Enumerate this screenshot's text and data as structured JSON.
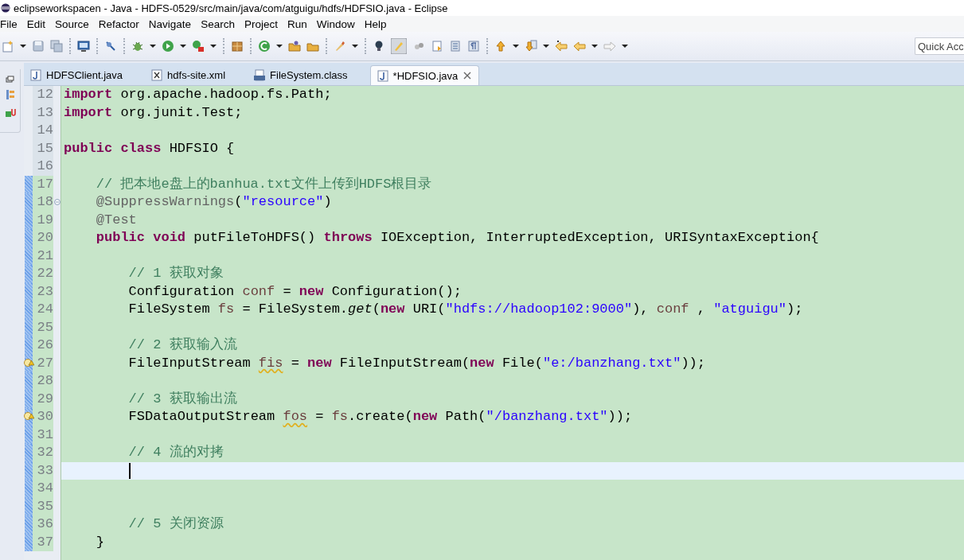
{
  "window": {
    "title": "eclipseworkspacen - Java - HDFS-0529/src/main/java/com/atguigu/hdfs/HDFSIO.java - Eclipse"
  },
  "menu": [
    "File",
    "Edit",
    "Source",
    "Refactor",
    "Navigate",
    "Search",
    "Project",
    "Run",
    "Window",
    "Help"
  ],
  "quick_access": {
    "placeholder": "Quick Acc"
  },
  "tabs": [
    {
      "label": "HDFSClient.java",
      "kind": "java",
      "selected": false
    },
    {
      "label": "hdfs-site.xml",
      "kind": "xml",
      "selected": false
    },
    {
      "label": "FileSystem.class",
      "kind": "class",
      "selected": false
    },
    {
      "label": "*HDFSIO.java",
      "kind": "java",
      "selected": true
    }
  ],
  "editor": {
    "lines": [
      {
        "number": "12",
        "changed": false,
        "warning": false,
        "foldable": false,
        "current": false,
        "tokens": [
          {
            "kind": "keyword",
            "text": "import"
          },
          {
            "kind": "plain",
            "text": " org.apache.hadoop.fs.Path;"
          }
        ]
      },
      {
        "number": "13",
        "changed": false,
        "warning": false,
        "foldable": false,
        "current": false,
        "tokens": [
          {
            "kind": "keyword",
            "text": "import"
          },
          {
            "kind": "plain",
            "text": " org.junit.Test;"
          }
        ]
      },
      {
        "number": "14",
        "changed": false,
        "warning": false,
        "foldable": false,
        "current": false
      },
      {
        "number": "15",
        "changed": false,
        "warning": false,
        "foldable": false,
        "current": false,
        "tokens": [
          {
            "kind": "keyword",
            "text": "public"
          },
          {
            "kind": "keyword",
            "text": " class"
          },
          {
            "kind": "plain",
            "text": " HDFSIO {"
          }
        ]
      },
      {
        "number": "16",
        "changed": false,
        "warning": false,
        "foldable": false,
        "current": false
      },
      {
        "number": "17",
        "changed": true,
        "warning": false,
        "foldable": false,
        "current": false,
        "tokens": [
          {
            "kind": "comment",
            "text": "    // 把本地e盘上的banhua.txt文件上传到HDFS根目录"
          }
        ]
      },
      {
        "number": "18",
        "changed": true,
        "warning": false,
        "foldable": true,
        "current": false,
        "tokens": [
          {
            "kind": "annotation",
            "text": "    @SuppressWarnings"
          },
          {
            "kind": "plain",
            "text": "("
          },
          {
            "kind": "string",
            "text": "\"resource\""
          },
          {
            "kind": "plain",
            "text": ")"
          }
        ]
      },
      {
        "number": "19",
        "changed": true,
        "warning": false,
        "foldable": false,
        "current": false,
        "tokens": [
          {
            "kind": "annotation",
            "text": "    @Test"
          }
        ]
      },
      {
        "number": "20",
        "changed": true,
        "warning": false,
        "foldable": false,
        "current": false,
        "tokens": [
          {
            "kind": "keyword",
            "text": "    public"
          },
          {
            "kind": "keyword",
            "text": " void"
          },
          {
            "kind": "plain",
            "text": " putFileToHDFS() "
          },
          {
            "kind": "keyword",
            "text": "throws"
          },
          {
            "kind": "plain",
            "text": " IOException, InterruptedException, URISyntaxException{"
          }
        ]
      },
      {
        "number": "21",
        "changed": true,
        "warning": false,
        "foldable": false,
        "current": false
      },
      {
        "number": "22",
        "changed": true,
        "warning": false,
        "foldable": false,
        "current": false,
        "tokens": [
          {
            "kind": "comment",
            "text": "        // 1 获取对象"
          }
        ]
      },
      {
        "number": "23",
        "changed": true,
        "warning": false,
        "foldable": false,
        "current": false,
        "tokens": [
          {
            "kind": "plain",
            "text": "        Configuration "
          },
          {
            "kind": "local",
            "text": "conf"
          },
          {
            "kind": "plain",
            "text": " = "
          },
          {
            "kind": "keyword",
            "text": "new"
          },
          {
            "kind": "plain",
            "text": " Configuration();"
          }
        ]
      },
      {
        "number": "24",
        "changed": true,
        "warning": false,
        "foldable": false,
        "current": false,
        "tokens": [
          {
            "kind": "plain",
            "text": "        FileSystem "
          },
          {
            "kind": "local",
            "text": "fs"
          },
          {
            "kind": "plain",
            "text": " = FileSystem."
          },
          {
            "kind": "static_method",
            "text": "get"
          },
          {
            "kind": "plain",
            "text": "("
          },
          {
            "kind": "keyword",
            "text": "new"
          },
          {
            "kind": "plain",
            "text": " URI("
          },
          {
            "kind": "string",
            "text": "\"hdfs://hadoop102:9000\""
          },
          {
            "kind": "plain",
            "text": "), "
          },
          {
            "kind": "local",
            "text": "conf"
          },
          {
            "kind": "plain",
            "text": " , "
          },
          {
            "kind": "string",
            "text": "\"atguigu\""
          },
          {
            "kind": "plain",
            "text": ");"
          }
        ]
      },
      {
        "number": "25",
        "changed": true,
        "warning": false,
        "foldable": false,
        "current": false
      },
      {
        "number": "26",
        "changed": true,
        "warning": false,
        "foldable": false,
        "current": false,
        "tokens": [
          {
            "kind": "comment",
            "text": "        // 2 获取输入流"
          }
        ]
      },
      {
        "number": "27",
        "changed": true,
        "warning": true,
        "foldable": false,
        "current": false,
        "tokens": [
          {
            "kind": "plain",
            "text": "        FileInputStream "
          },
          {
            "kind": "warn_local",
            "text": "fis"
          },
          {
            "kind": "plain",
            "text": " = "
          },
          {
            "kind": "keyword",
            "text": "new"
          },
          {
            "kind": "plain",
            "text": " FileInputStream("
          },
          {
            "kind": "keyword",
            "text": "new"
          },
          {
            "kind": "plain",
            "text": " File("
          },
          {
            "kind": "string",
            "text": "\"e:/banzhang.txt\""
          },
          {
            "kind": "plain",
            "text": "));"
          }
        ]
      },
      {
        "number": "28",
        "changed": true,
        "warning": false,
        "foldable": false,
        "current": false
      },
      {
        "number": "29",
        "changed": true,
        "warning": false,
        "foldable": false,
        "current": false,
        "tokens": [
          {
            "kind": "comment",
            "text": "        // 3 获取输出流"
          }
        ]
      },
      {
        "number": "30",
        "changed": true,
        "warning": true,
        "foldable": false,
        "current": false,
        "tokens": [
          {
            "kind": "plain",
            "text": "        FSDataOutputStream "
          },
          {
            "kind": "warn_local",
            "text": "fos"
          },
          {
            "kind": "plain",
            "text": " = "
          },
          {
            "kind": "local",
            "text": "fs"
          },
          {
            "kind": "plain",
            "text": ".create("
          },
          {
            "kind": "keyword",
            "text": "new"
          },
          {
            "kind": "plain",
            "text": " Path("
          },
          {
            "kind": "string",
            "text": "\"/banzhang.txt\""
          },
          {
            "kind": "plain",
            "text": "));"
          }
        ]
      },
      {
        "number": "31",
        "changed": true,
        "warning": false,
        "foldable": false,
        "current": false
      },
      {
        "number": "32",
        "changed": true,
        "warning": false,
        "foldable": false,
        "current": false,
        "tokens": [
          {
            "kind": "comment",
            "text": "        // 4 流的对拷"
          }
        ]
      },
      {
        "number": "33",
        "changed": true,
        "warning": false,
        "foldable": false,
        "current": true
      },
      {
        "number": "34",
        "changed": true,
        "warning": false,
        "foldable": false,
        "current": false
      },
      {
        "number": "35",
        "changed": true,
        "warning": false,
        "foldable": false,
        "current": false
      },
      {
        "number": "36",
        "changed": true,
        "warning": false,
        "foldable": false,
        "current": false,
        "tokens": [
          {
            "kind": "comment",
            "text": "        // 5 关闭资源"
          }
        ]
      },
      {
        "number": "37",
        "changed": true,
        "warning": false,
        "foldable": false,
        "current": false,
        "tokens": [
          {
            "kind": "plain",
            "text": "    }"
          }
        ]
      }
    ]
  }
}
